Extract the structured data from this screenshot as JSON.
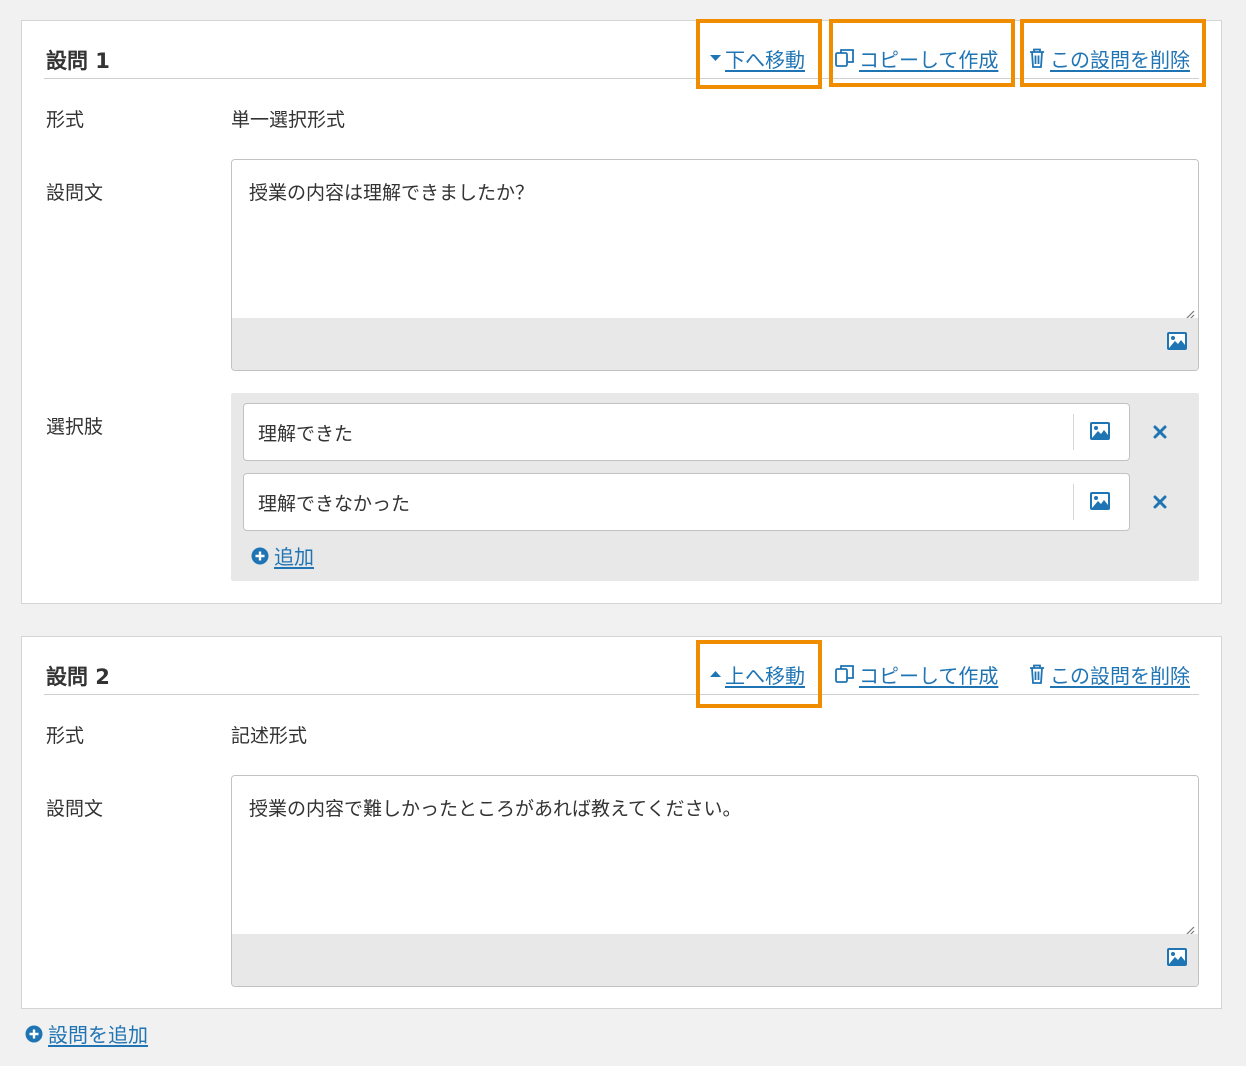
{
  "questions": [
    {
      "title": "設問 1",
      "actions": {
        "move_label": "下へ移動",
        "copy_label": "コピーして作成",
        "delete_label": "この設問を削除"
      },
      "format_label": "形式",
      "format_value": "単一選択形式",
      "text_label": "設問文",
      "text_value": "授業の内容は理解できましたか？",
      "choices_label": "選択肢",
      "choices": [
        "理解できた",
        "理解できなかった"
      ],
      "add_choice_label": "追加"
    },
    {
      "title": "設問 2",
      "actions": {
        "move_label": "上へ移動",
        "copy_label": "コピーして作成",
        "delete_label": "この設問を削除"
      },
      "format_label": "形式",
      "format_value": "記述形式",
      "text_label": "設問文",
      "text_value": "授業の内容で難しかったところがあれば教えてください。"
    }
  ],
  "add_question_label": "設問を追加",
  "colors": {
    "link": "#1f74b4",
    "highlight": "#f08c00",
    "panel_bg": "#ffffff",
    "page_bg": "#f1f1f1",
    "toolbar_bg": "#e8e8e8"
  },
  "icons": {
    "move_down": "caret-down-icon",
    "move_up": "caret-up-icon",
    "copy": "copy-icon",
    "delete": "trash-icon",
    "image": "image-icon",
    "remove": "close-icon",
    "add": "plus-circle-icon"
  }
}
